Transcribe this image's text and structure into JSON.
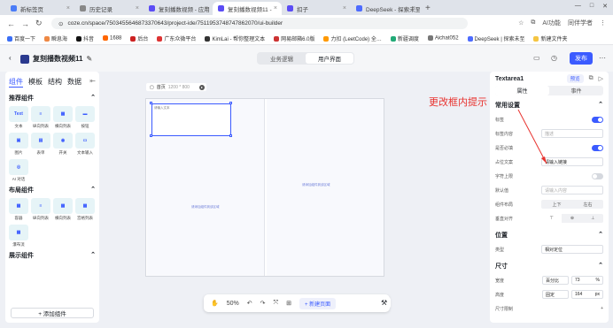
{
  "browser": {
    "tabs": [
      {
        "label": "新标签页"
      },
      {
        "label": "历史记录"
      },
      {
        "label": "复刻播数视频 - 应用"
      },
      {
        "label": "复刻播数视频11 -"
      },
      {
        "label": "扣子"
      },
      {
        "label": "DeepSeek - 探索未至"
      }
    ],
    "url": "coze.cn/space/7503455646873370643/project-ide/7511953748747862070/ui-builder",
    "right_label": "AI功能",
    "user_label": "同伴学者"
  },
  "bookmarks": [
    "百度一下",
    "瞬息海",
    "抖音",
    "1688",
    "后台",
    "广东众微平台",
    "KimLai - 帮你整理文本",
    "网易邮箱6.0版",
    "力扣 (LeetCode) 全…",
    "新疆调度",
    "Aichat052",
    "DeepSeek | 探索未至",
    "新建文件夹"
  ],
  "app": {
    "title": "复刻播数视频11",
    "tab_logic": "业务逻辑",
    "tab_ui": "用户界面",
    "publish": "发布"
  },
  "left": {
    "tabs": [
      "组件",
      "模板",
      "结构",
      "数据"
    ],
    "section1": "推荐组件",
    "recommended": [
      {
        "label": "文本",
        "icon": "Text"
      },
      {
        "label": "纵向列表",
        "icon": "≡"
      },
      {
        "label": "横向列表",
        "icon": "▦"
      },
      {
        "label": "按钮",
        "icon": "▬"
      },
      {
        "label": "图片",
        "icon": "▣"
      },
      {
        "label": "表单",
        "icon": "▤"
      },
      {
        "label": "开关",
        "icon": "◉"
      },
      {
        "label": "文本输入",
        "icon": "▭"
      },
      {
        "label": "AI 对话",
        "icon": "◎"
      }
    ],
    "section2": "布局组件",
    "layout": [
      {
        "label": "容器",
        "icon": "▦"
      },
      {
        "label": "纵向列表",
        "icon": "≡"
      },
      {
        "label": "横向列表",
        "icon": "▦"
      },
      {
        "label": "宫格列表",
        "icon": "▦"
      },
      {
        "label": "瀑布流",
        "icon": "▦"
      }
    ],
    "section3": "展示组件",
    "add_button": "+ 添加组件"
  },
  "canvas": {
    "page_label": "首页",
    "page_size": "1200 * 800",
    "textarea_placeholder": "请输入文本",
    "left_hint": "请添加组件到该区域",
    "right_hint": "请添加组件到该区域",
    "zoom": "50%",
    "new_page": "+ 新建页面"
  },
  "annotation": "更改框内提示",
  "props": {
    "component": "Textarea1",
    "preview": "预览",
    "tab_attr": "属性",
    "tab_event": "事件",
    "section_common": "常用设置",
    "rows": [
      {
        "label": "标签",
        "type": "switch",
        "on": true
      },
      {
        "label": "标签内容",
        "type": "input",
        "value": "描述"
      },
      {
        "label": "是否必填",
        "type": "switch",
        "on": true
      },
      {
        "label": "占位文案",
        "type": "input",
        "value": "请输入链接",
        "filled": true
      },
      {
        "label": "字符上限",
        "type": "switch",
        "on": false
      },
      {
        "label": "默认值",
        "type": "input",
        "value": "请输入内容"
      },
      {
        "label": "组件布局",
        "type": "seg",
        "options": [
          "上下",
          "左右"
        ]
      },
      {
        "label": "垂直对齐",
        "type": "seg",
        "options": [
          "⊤",
          "⊕",
          "⊥"
        ]
      }
    ],
    "section_pos": "位置",
    "pos_type_label": "类型",
    "pos_type_value": "相对定位",
    "section_size": "尺寸",
    "width_label": "宽度",
    "width_mode": "百分比",
    "width_value": "73",
    "width_unit": "%",
    "height_label": "高度",
    "height_mode": "固定",
    "height_value": "164",
    "height_unit": "px",
    "size_limit": "尺寸限制"
  }
}
